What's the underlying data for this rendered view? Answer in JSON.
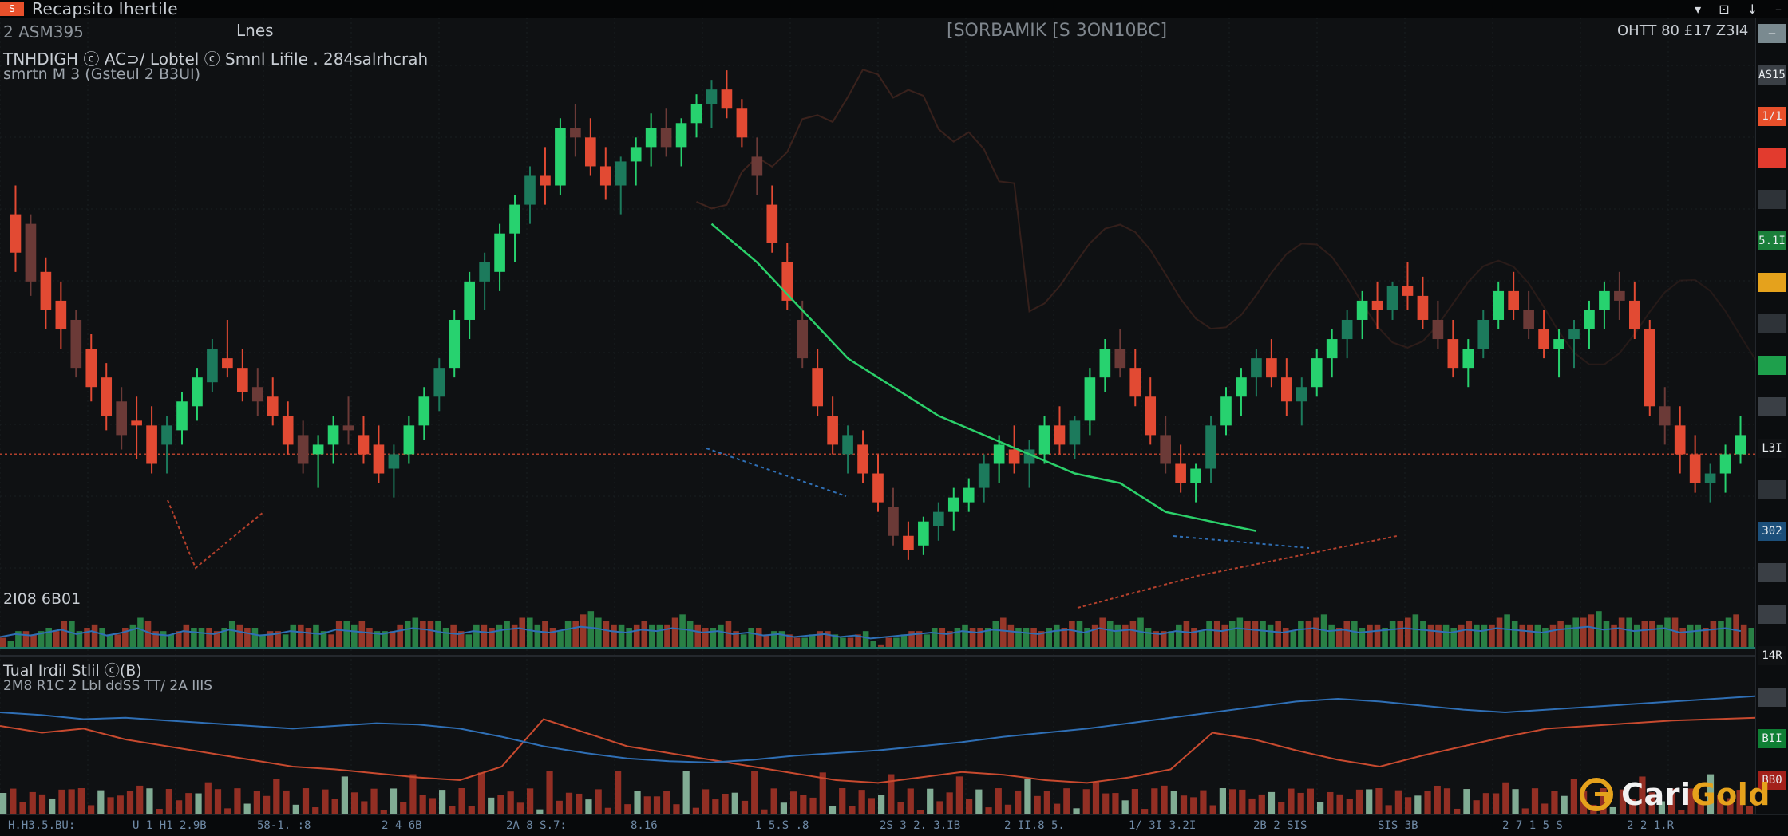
{
  "window": {
    "title": "Recapsito Ihertile",
    "app_icon": "S",
    "controls": [
      "▾",
      "⊡",
      "↓",
      "–"
    ]
  },
  "header": {
    "left_line1": "TNHDIGH   ⓒ AC⊃/ Lobtel  ⓒ Smnl Lifile . 284salrhcrah",
    "left_line2": "smrtn M 3  (Gsteul 2 B3UI)",
    "tab": "Lnes",
    "tab_prefix": "2 ASM395",
    "center": "[SORBAMIK [S 3ON10BC]",
    "right": "OHTT 80 £17 Z3I4"
  },
  "volume_label": "2I08 6B01",
  "indicator": {
    "label1": "Tual Irdil   Stlil ⓒ(B)",
    "label2": "2M8 R1C 2  Lbl  ddSS TT/ 2A  IIIS"
  },
  "right_scale": {
    "tags": [
      {
        "text": "—",
        "color": "#7a8a90"
      },
      {
        "text": "AS15",
        "color": "#3b4046"
      },
      {
        "text": "1/1",
        "color": "#e8502b"
      },
      {
        "text": "",
        "color": "#e23b2e"
      },
      {
        "text": "",
        "color": "#2e3338"
      },
      {
        "text": "5.1I",
        "color": "#1a7f3a"
      },
      {
        "text": "",
        "color": "#e5a21c"
      },
      {
        "text": "",
        "color": "#2e3338"
      },
      {
        "text": "",
        "color": "#1ea04c"
      },
      {
        "text": "",
        "color": "#3a3f45"
      },
      {
        "text": "L3I",
        "color": "#0f1113"
      },
      {
        "text": "",
        "color": "#2e3338"
      },
      {
        "text": "302",
        "color": "#1c4f7a"
      },
      {
        "text": "",
        "color": "#3a3f45"
      },
      {
        "text": "",
        "color": "#3a3f45"
      },
      {
        "text": "14R",
        "color": "#0f1113"
      },
      {
        "text": "",
        "color": "#3a3f45"
      },
      {
        "text": "BII",
        "color": "#0f7f34"
      },
      {
        "text": "BB0",
        "color": "#a3201a"
      }
    ]
  },
  "bottom_axis": [
    "H.H3.5.BU:",
    "U 1 H1 2.9B",
    "58-1.  :8",
    "2 4 6B",
    "2A 8 S.7:",
    "8.16",
    "1 5.S .8",
    "2S 3 2. 3.IB",
    "2 II.8 5.",
    "1/ 3I 3.2I",
    "2B 2  SIS",
    "SIS 3B",
    "2 7 1 5 S",
    "2 2 1.R"
  ],
  "logo": {
    "part1": "Cari",
    "part2": "Gold"
  },
  "colors": {
    "up": "#27d26f",
    "up_dark": "#1c7a5c",
    "down": "#e24a33",
    "down_dark": "#6b3a37",
    "ma_green": "#2bd06a",
    "ma_red": "#a83a2a",
    "blue": "#2f6fb5",
    "orange": "#e5a21c"
  },
  "chart_data": [
    {
      "type": "candlestick",
      "title": "",
      "xlabel": "",
      "ylabel": "",
      "ylim": [
        0,
        100
      ],
      "grid": true,
      "candles": [
        [
          72,
          78,
          60,
          64
        ],
        [
          70,
          72,
          55,
          58
        ],
        [
          60,
          63,
          48,
          52
        ],
        [
          54,
          58,
          44,
          48
        ],
        [
          50,
          52,
          38,
          40
        ],
        [
          44,
          47,
          33,
          36
        ],
        [
          38,
          41,
          27,
          30
        ],
        [
          33,
          36,
          23,
          26
        ],
        [
          29,
          34,
          21,
          28
        ],
        [
          28,
          32,
          18,
          20
        ],
        [
          24,
          30,
          18,
          28
        ],
        [
          27,
          35,
          24,
          33
        ],
        [
          32,
          40,
          29,
          38
        ],
        [
          37,
          46,
          35,
          44
        ],
        [
          42,
          50,
          38,
          40
        ],
        [
          40,
          44,
          33,
          35
        ],
        [
          36,
          40,
          30,
          33
        ],
        [
          34,
          38,
          28,
          30
        ],
        [
          30,
          33,
          22,
          24
        ],
        [
          26,
          29,
          18,
          20
        ],
        [
          22,
          26,
          15,
          24
        ],
        [
          24,
          30,
          20,
          28
        ],
        [
          28,
          34,
          24,
          27
        ],
        [
          26,
          30,
          20,
          22
        ],
        [
          24,
          28,
          16,
          18
        ],
        [
          19,
          24,
          13,
          22
        ],
        [
          22,
          30,
          20,
          28
        ],
        [
          28,
          36,
          25,
          34
        ],
        [
          34,
          42,
          31,
          40
        ],
        [
          40,
          52,
          38,
          50
        ],
        [
          50,
          60,
          46,
          58
        ],
        [
          58,
          64,
          52,
          62
        ],
        [
          60,
          70,
          56,
          68
        ],
        [
          68,
          76,
          62,
          74
        ],
        [
          74,
          82,
          70,
          80
        ],
        [
          80,
          86,
          74,
          78
        ],
        [
          78,
          92,
          76,
          90
        ],
        [
          90,
          95,
          84,
          88
        ],
        [
          88,
          92,
          80,
          82
        ],
        [
          82,
          86,
          75,
          78
        ],
        [
          78,
          84,
          72,
          83
        ],
        [
          83,
          88,
          78,
          86
        ],
        [
          86,
          93,
          82,
          90
        ],
        [
          90,
          94,
          84,
          86
        ],
        [
          86,
          92,
          82,
          91
        ],
        [
          91,
          97,
          88,
          95
        ],
        [
          95,
          100,
          90,
          98
        ],
        [
          98,
          102,
          92,
          94
        ],
        [
          94,
          96,
          86,
          88
        ],
        [
          84,
          88,
          76,
          80
        ],
        [
          74,
          78,
          64,
          66
        ],
        [
          62,
          66,
          52,
          54
        ],
        [
          50,
          54,
          40,
          42
        ],
        [
          40,
          44,
          30,
          32
        ],
        [
          30,
          34,
          22,
          24
        ],
        [
          22,
          28,
          18,
          26
        ],
        [
          24,
          27,
          16,
          18
        ],
        [
          18,
          22,
          10,
          12
        ],
        [
          11,
          15,
          3,
          5
        ],
        [
          5,
          8,
          0,
          2
        ],
        [
          3,
          9,
          1,
          8
        ],
        [
          7,
          12,
          4,
          10
        ],
        [
          10,
          15,
          6,
          13
        ],
        [
          12,
          17,
          10,
          15
        ],
        [
          15,
          22,
          12,
          20
        ],
        [
          20,
          26,
          16,
          24
        ],
        [
          23,
          28,
          18,
          20
        ],
        [
          20,
          25,
          15,
          23
        ],
        [
          22,
          30,
          20,
          28
        ],
        [
          28,
          32,
          22,
          24
        ],
        [
          24,
          30,
          21,
          29
        ],
        [
          29,
          40,
          26,
          38
        ],
        [
          38,
          46,
          35,
          44
        ],
        [
          44,
          48,
          38,
          40
        ],
        [
          40,
          44,
          32,
          34
        ],
        [
          34,
          38,
          24,
          26
        ],
        [
          26,
          30,
          18,
          20
        ],
        [
          20,
          24,
          14,
          16
        ],
        [
          16,
          20,
          12,
          19
        ],
        [
          19,
          30,
          16,
          28
        ],
        [
          28,
          36,
          26,
          34
        ],
        [
          34,
          40,
          30,
          38
        ],
        [
          38,
          44,
          34,
          42
        ],
        [
          42,
          46,
          36,
          38
        ],
        [
          38,
          42,
          30,
          33
        ],
        [
          33,
          38,
          28,
          36
        ],
        [
          36,
          44,
          34,
          42
        ],
        [
          42,
          48,
          38,
          46
        ],
        [
          46,
          52,
          42,
          50
        ],
        [
          50,
          56,
          46,
          54
        ],
        [
          54,
          58,
          48,
          52
        ],
        [
          52,
          58,
          50,
          57
        ],
        [
          57,
          62,
          52,
          55
        ],
        [
          55,
          59,
          48,
          50
        ],
        [
          50,
          54,
          44,
          46
        ],
        [
          46,
          50,
          38,
          40
        ],
        [
          40,
          46,
          36,
          44
        ],
        [
          44,
          52,
          42,
          50
        ],
        [
          50,
          58,
          48,
          56
        ],
        [
          56,
          60,
          50,
          52
        ],
        [
          52,
          56,
          46,
          48
        ],
        [
          48,
          52,
          42,
          44
        ],
        [
          44,
          48,
          38,
          46
        ],
        [
          46,
          50,
          40,
          48
        ],
        [
          48,
          54,
          44,
          52
        ],
        [
          52,
          58,
          48,
          56
        ],
        [
          56,
          60,
          50,
          54
        ],
        [
          54,
          58,
          46,
          48
        ],
        [
          48,
          50,
          30,
          32
        ],
        [
          32,
          36,
          24,
          28
        ],
        [
          28,
          32,
          18,
          22
        ],
        [
          22,
          26,
          14,
          16
        ],
        [
          16,
          20,
          12,
          18
        ],
        [
          18,
          24,
          14,
          22
        ],
        [
          22,
          30,
          20,
          26
        ]
      ],
      "volumes": [
        3,
        5,
        4,
        6,
        8,
        5,
        7,
        4,
        6,
        9,
        5,
        4,
        7,
        6,
        5,
        8,
        6,
        4,
        5,
        7,
        6,
        5,
        8,
        7,
        6,
        5,
        7,
        9,
        8,
        6,
        5,
        7,
        6,
        8,
        9,
        7,
        6,
        8,
        10,
        9,
        7,
        6,
        8,
        7,
        9,
        8,
        6,
        7,
        5,
        6,
        4,
        5,
        3,
        4,
        5,
        3,
        4,
        2,
        3,
        4,
        5,
        6,
        5,
        7,
        6,
        8,
        7,
        6,
        5,
        7,
        8,
        6,
        9,
        7,
        8,
        6,
        5,
        7,
        6,
        8,
        7,
        9,
        8,
        7,
        6,
        8,
        9,
        7,
        8,
        6,
        7,
        8,
        9,
        8,
        7,
        6,
        8,
        7,
        9,
        8,
        7,
        6,
        8,
        9,
        10,
        8,
        9,
        7,
        8,
        9,
        6,
        7,
        8,
        9,
        7
      ],
      "moving_average_green": [
        [
          46,
          70
        ],
        [
          49,
          62
        ],
        [
          52,
          52
        ],
        [
          55,
          42
        ],
        [
          58,
          36
        ],
        [
          61,
          30
        ],
        [
          64,
          26
        ],
        [
          67,
          22
        ],
        [
          70,
          18
        ],
        [
          73,
          16
        ],
        [
          76,
          10
        ],
        [
          79,
          8
        ],
        [
          82,
          6
        ]
      ],
      "horizontal_level": 22
    },
    {
      "type": "line",
      "title": "",
      "series": [
        {
          "values": [
            60,
            55,
            58,
            50,
            45,
            40,
            35,
            30,
            28,
            25,
            22,
            20,
            30,
            65,
            55,
            45,
            40,
            35,
            30,
            25,
            20,
            18,
            22,
            26,
            24,
            20,
            18,
            22,
            28,
            55,
            50,
            42,
            35,
            30,
            38,
            45,
            52,
            58,
            60,
            62,
            64,
            65,
            66
          ]
        },
        {
          "values": [
            70,
            68,
            65,
            66,
            64,
            62,
            60,
            58,
            60,
            62,
            61,
            58,
            52,
            45,
            40,
            36,
            34,
            33,
            35,
            38,
            40,
            42,
            45,
            48,
            52,
            55,
            58,
            62,
            66,
            70,
            74,
            78,
            80,
            78,
            75,
            72,
            70,
            72,
            74,
            76,
            78,
            80,
            82
          ]
        }
      ]
    }
  ]
}
